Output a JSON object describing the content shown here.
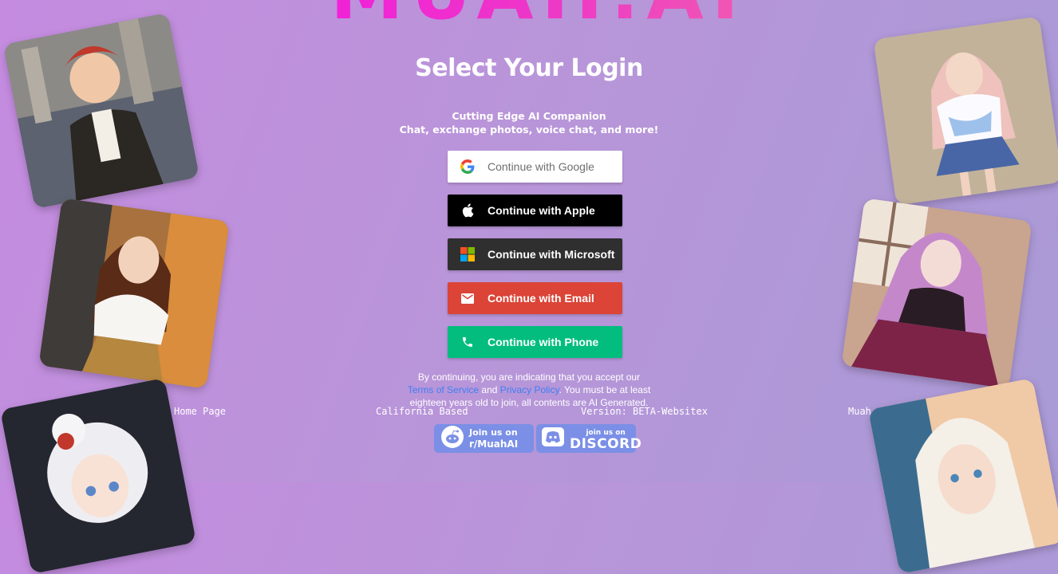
{
  "brand": {
    "logo_text": "MUAH.AI"
  },
  "page": {
    "title": "Select Your Login",
    "tagline": "Cutting Edge AI Companion",
    "description": "Chat, exchange photos, voice chat, and more!"
  },
  "login_buttons": {
    "google": {
      "label": "Continue with Google",
      "icon": "google-icon"
    },
    "apple": {
      "label": "Continue with Apple",
      "icon": "apple-icon"
    },
    "microsoft": {
      "label": "Continue with Microsoft",
      "icon": "microsoft-icon"
    },
    "email": {
      "label": "Continue with Email",
      "icon": "mail-icon"
    },
    "phone": {
      "label": "Continue with Phone",
      "icon": "phone-icon"
    }
  },
  "legal": {
    "prefix": "By continuing, you are indicating that you accept our",
    "terms": "Terms of Service",
    "and": "and",
    "privacy": "Privacy Policy",
    "suffix": ". You must be at least eighteen years old to join, all contents are AI Generated."
  },
  "footer": {
    "home": "Home Page",
    "location": "California Based",
    "version": "Version: BETA-Websitex",
    "name": "Muah.AI"
  },
  "community": {
    "reddit": {
      "small": "Join us on",
      "large": "r/MuahAI",
      "icon": "reddit-icon"
    },
    "discord": {
      "small": "join us on",
      "large": "DISCORD",
      "icon": "discord-icon"
    }
  },
  "colors": {
    "background_start": "#c58be0",
    "background_end": "#a99ad6",
    "logo": "#ee39c6",
    "google_bg": "#ffffff",
    "apple_bg": "#000000",
    "microsoft_bg": "#2f2f2f",
    "email_bg": "#db4437",
    "phone_bg": "#02bd7e",
    "link": "#3f7ff3",
    "badge_bg": "#7b8fe6"
  },
  "gallery": [
    {
      "id": "character-1"
    },
    {
      "id": "character-2"
    },
    {
      "id": "character-3"
    },
    {
      "id": "character-4"
    },
    {
      "id": "character-5"
    },
    {
      "id": "character-6"
    }
  ]
}
